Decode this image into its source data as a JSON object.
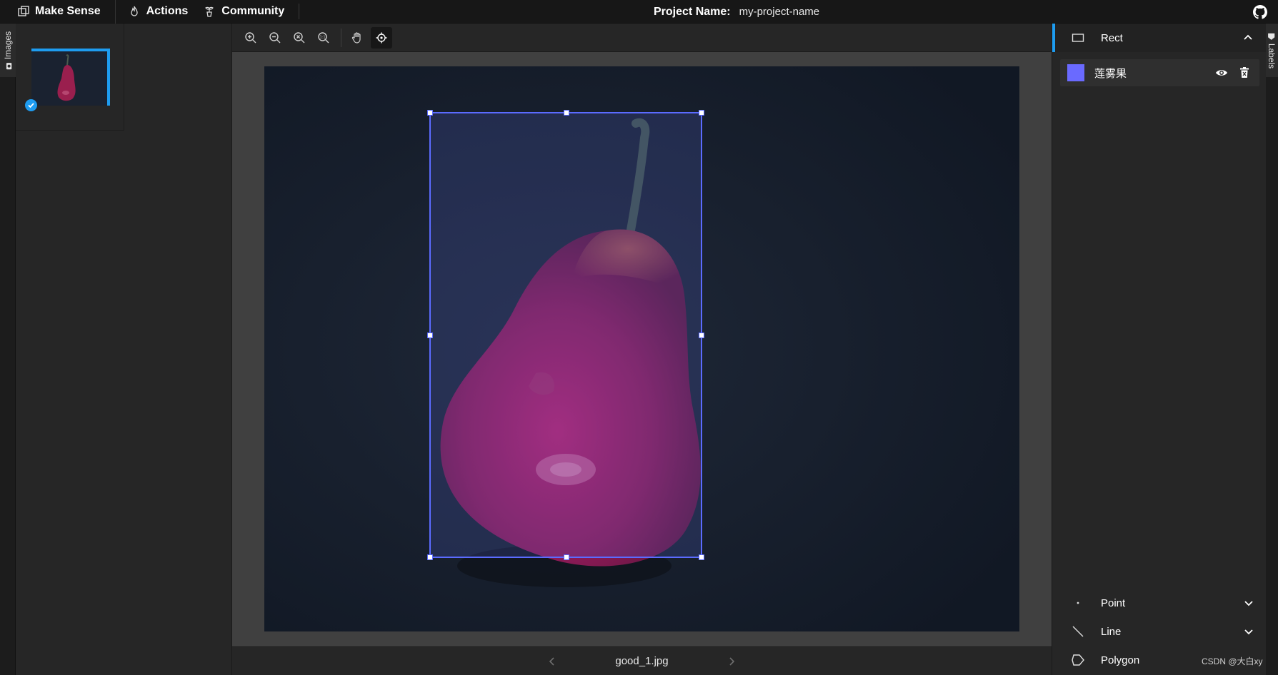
{
  "topbar": {
    "brand": "Make Sense",
    "menu": [
      {
        "label": "Actions",
        "icon": "flame-icon"
      },
      {
        "label": "Community",
        "icon": "plant-icon"
      }
    ],
    "project_label": "Project Name:",
    "project_name": "my-project-name"
  },
  "left_tab": {
    "label": "Images"
  },
  "right_tab": {
    "label": "Labels"
  },
  "images": [
    {
      "file": "good_1.jpg",
      "checked": true
    }
  ],
  "toolbar": {
    "tools": [
      "zoom-in-icon",
      "zoom-out-icon",
      "zoom-fit-icon",
      "zoom-max-icon",
      "pan-hand-icon",
      "crosshair-icon"
    ],
    "active_tool": "crosshair-icon"
  },
  "editor": {
    "file_name": "good_1.jpg"
  },
  "label_panel": {
    "active_tool": "Rect",
    "labels": [
      {
        "name": "莲雾果",
        "color": "#6a6aff"
      }
    ],
    "other_tools": [
      {
        "name": "Point"
      },
      {
        "name": "Line"
      },
      {
        "name": "Polygon"
      }
    ]
  },
  "colors": {
    "accent": "#1e9cf0",
    "bbox": "#5b6bff",
    "topbar": "#171717",
    "panel": "#262626"
  },
  "watermark": "CSDN @大白xy"
}
